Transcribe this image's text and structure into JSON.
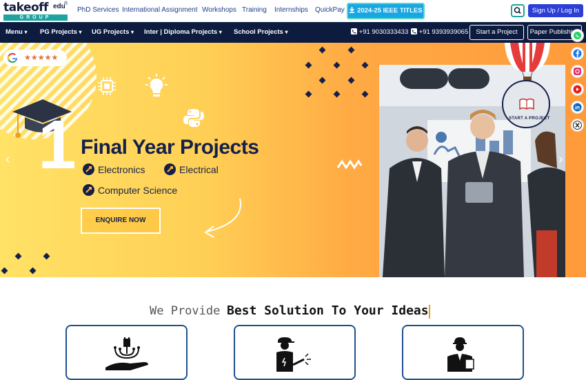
{
  "brand": {
    "logo_main": "takeoff",
    "logo_edu": "edu",
    "logo_reg": "®",
    "logo_group": "GROUP"
  },
  "toplinks": [
    "PhD Services",
    "International Assignment",
    "Workshops",
    "Training",
    "Internships",
    "QuickPay"
  ],
  "ieee_button": "2024-25 IEEE TITLES",
  "signup": "Sign Up / Log In",
  "nav": {
    "items": [
      "Menu",
      "PG Projects",
      "UG Projects",
      "Inter | Diploma Projects",
      "School Projects"
    ],
    "phones": [
      "+91 9030333433",
      "+91 9393939065"
    ],
    "start_project": "Start a Project",
    "paper_publishing": "Paper Publishing"
  },
  "hero": {
    "rating": "★★★★★",
    "big_number": "1",
    "title": "Final Year Projects",
    "features": [
      "Electronics",
      "Electrical",
      "Computer Science"
    ],
    "cta": "ENQUIRE NOW",
    "sticker": "START A PROJECT",
    "prev": "‹",
    "next": "›"
  },
  "social": [
    "whatsapp-icon",
    "facebook-icon",
    "instagram-icon",
    "youtube-icon",
    "linkedin-icon",
    "x-icon"
  ],
  "section": {
    "lead": "We Provide",
    "highlight": "Best Solution To Your Ideas"
  },
  "colors": {
    "navy": "#0d1b3f",
    "teal": "#1fa3a0",
    "blue_button": "#2b3fd6",
    "ieee_button": "#17a7e3",
    "hero_start": "#ffe266",
    "hero_end": "#ff9a3a"
  }
}
